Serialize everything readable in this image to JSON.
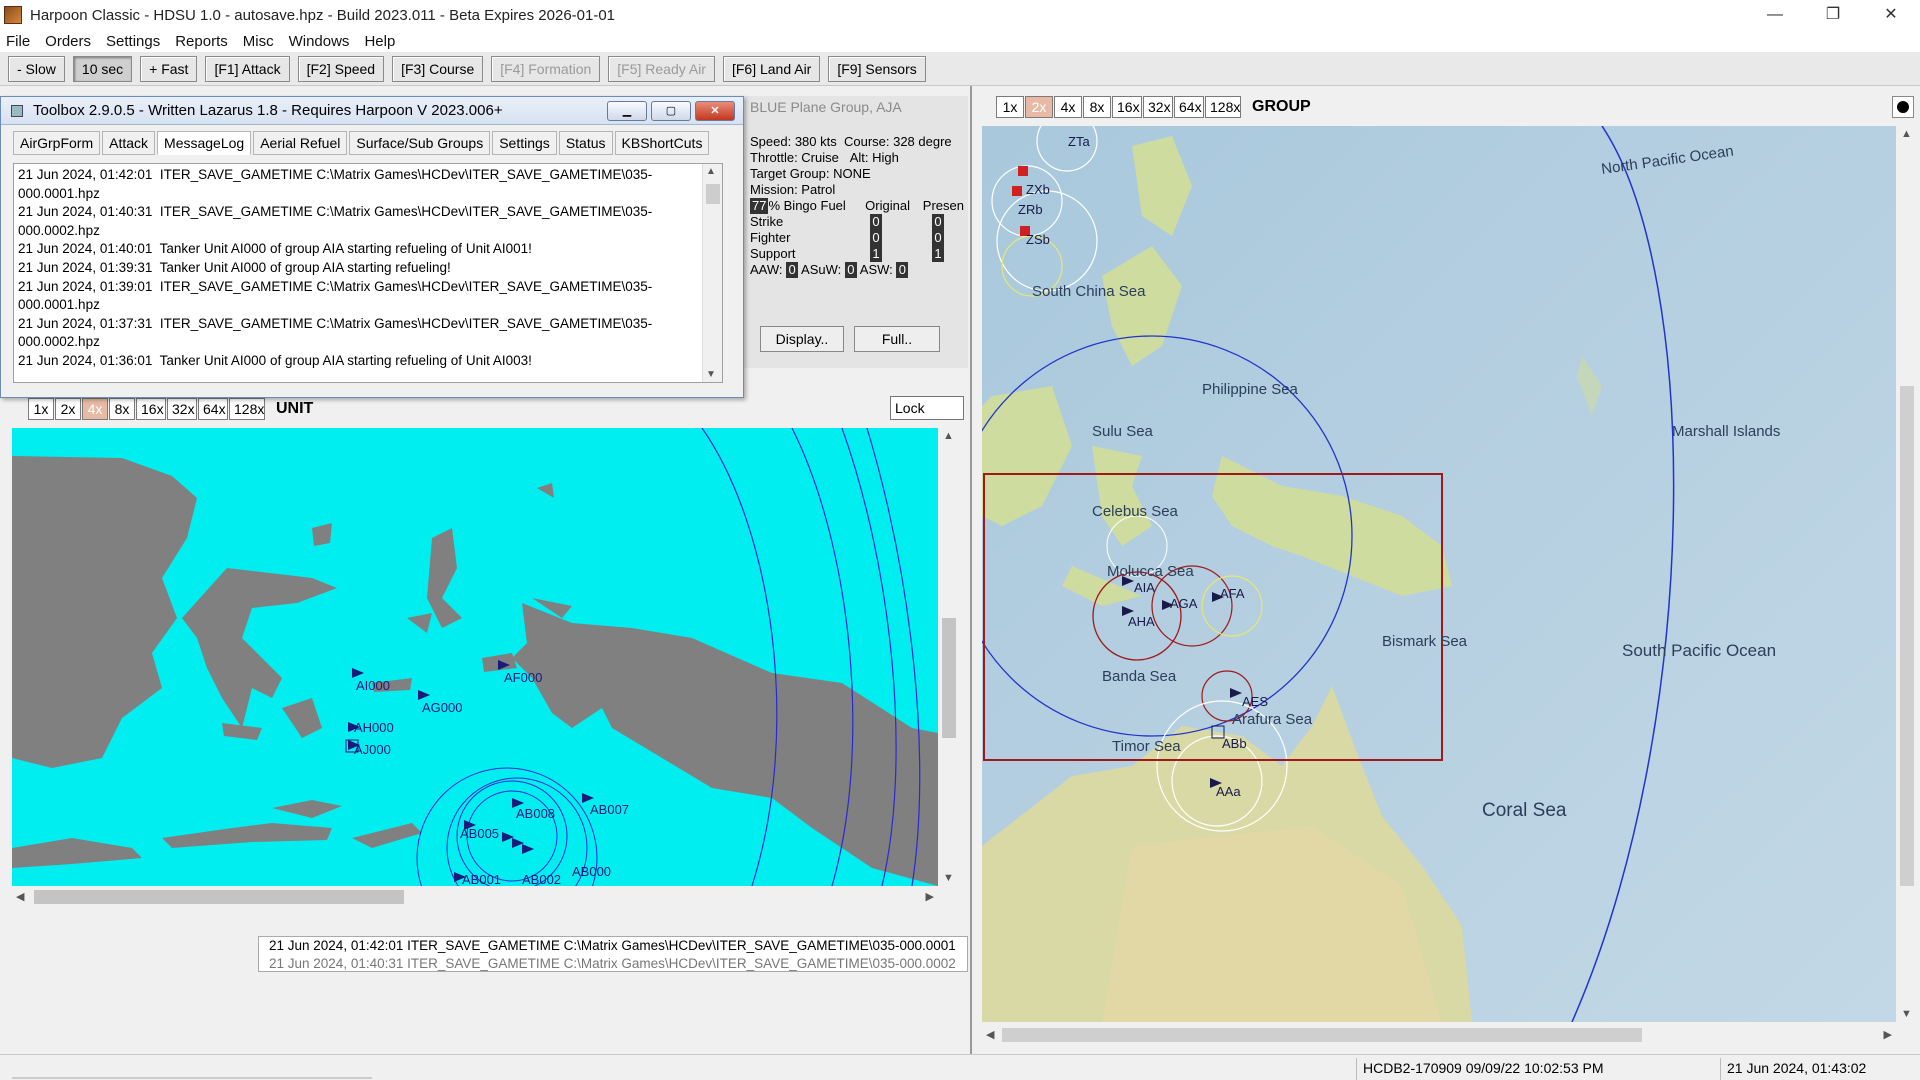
{
  "window": {
    "title": "Harpoon Classic - HDSU 1.0 - autosave.hpz - Build 2023.011 - Beta Expires 2026-01-01",
    "controls": [
      "—",
      "❐",
      "✕"
    ]
  },
  "menu": [
    "File",
    "Orders",
    "Settings",
    "Reports",
    "Misc",
    "Windows",
    "Help"
  ],
  "toolbar": [
    {
      "label": "- Slow",
      "state": "normal"
    },
    {
      "label": "10 sec",
      "state": "active"
    },
    {
      "label": "+ Fast",
      "state": "normal"
    },
    {
      "label": "[F1] Attack",
      "state": "normal"
    },
    {
      "label": "[F2] Speed",
      "state": "normal"
    },
    {
      "label": "[F3] Course",
      "state": "normal"
    },
    {
      "label": "[F4] Formation",
      "state": "disabled"
    },
    {
      "label": "[F5] Ready Air",
      "state": "disabled"
    },
    {
      "label": "[F6] Land Air",
      "state": "normal"
    },
    {
      "label": "[F9] Sensors",
      "state": "normal"
    }
  ],
  "toolbox": {
    "title": "Toolbox 2.9.0.5 - Written Lazarus 1.8 - Requires Harpoon V 2023.006+",
    "tabs": [
      "AirGrpForm",
      "Attack",
      "MessageLog",
      "Aerial Refuel",
      "Surface/Sub Groups",
      "Settings",
      "Status",
      "KBShortCuts"
    ],
    "selected_tab": "MessageLog",
    "log": [
      "21 Jun 2024, 01:42:01  ITER_SAVE_GAMETIME C:\\Matrix Games\\HCDev\\ITER_SAVE_GAMETIME\\035-000.0001.hpz",
      "21 Jun 2024, 01:40:31  ITER_SAVE_GAMETIME C:\\Matrix Games\\HCDev\\ITER_SAVE_GAMETIME\\035-000.0002.hpz",
      "21 Jun 2024, 01:40:01  Tanker Unit AI000 of group AIA starting refueling of Unit AI001!",
      "21 Jun 2024, 01:39:31  Tanker Unit AI000 of group AIA starting refueling!",
      "21 Jun 2024, 01:39:01  ITER_SAVE_GAMETIME C:\\Matrix Games\\HCDev\\ITER_SAVE_GAMETIME\\035-000.0001.hpz",
      "21 Jun 2024, 01:37:31  ITER_SAVE_GAMETIME C:\\Matrix Games\\HCDev\\ITER_SAVE_GAMETIME\\035-000.0002.hpz",
      "21 Jun 2024, 01:36:01  Tanker Unit AI000 of group AIA starting refueling of Unit AI003!"
    ]
  },
  "group_info": {
    "title": "BLUE Plane Group, AJA",
    "speed": "Speed: 380 kts",
    "course": "Course: 328 degre",
    "throttle": "Throttle: Cruise",
    "alt": "Alt: High",
    "target": "Target Group: NONE",
    "mission": "Mission: Patrol",
    "bingo_pct": "77",
    "bingo_label": "% Bingo Fuel",
    "col_original": "Original",
    "col_present": "Presen",
    "rows": [
      {
        "label": "Strike",
        "original": "0",
        "present": "0"
      },
      {
        "label": "Fighter",
        "original": "0",
        "present": "0"
      },
      {
        "label": "Support",
        "original": "1",
        "present": "1"
      }
    ],
    "aaw_label": "AAW:",
    "aaw": "0",
    "asuw_label": "ASuW:",
    "asuw": "0",
    "asw_label": "ASW:",
    "asw": "0",
    "display_btn": "Display..",
    "full_btn": "Full.."
  },
  "unit_map": {
    "zoom": [
      "1x",
      "2x",
      "4x",
      "8x",
      "16x",
      "32x",
      "64x",
      "128x"
    ],
    "selected_zoom": "4x",
    "label": "UNIT",
    "lock_label": "Lock",
    "units": [
      "AI000",
      "AF000",
      "AG000",
      "AH000",
      "AJ000",
      "AB008",
      "AB007",
      "AB005",
      "AB000",
      "AB001",
      "AB002"
    ],
    "colors": {
      "sea": "#00eef0",
      "land": "#808080",
      "unit": "#1a1a7a",
      "ring": "#2a2ad0"
    }
  },
  "message_strip": {
    "line1": "21 Jun 2024, 01:42:01  ITER_SAVE_GAMETIME C:\\Matrix Games\\HCDev\\ITER_SAVE_GAMETIME\\035-000.0001",
    "line2": "21 Jun 2024, 01:40:31  ITER_SAVE_GAMETIME C:\\Matrix Games\\HCDev\\ITER_SAVE_GAMETIME\\035-000.0002"
  },
  "group_map": {
    "zoom": [
      "1x",
      "2x",
      "4x",
      "8x",
      "16x",
      "32x",
      "64x",
      "128x"
    ],
    "selected_zoom": "2x",
    "label": "GROUP",
    "seas": [
      "North Pacific Ocean",
      "Philippine Sea",
      "Sulu Sea",
      "Celebus Sea",
      "Molucca Sea",
      "Banda Sea",
      "Timor Sea",
      "Arafura Sea",
      "Coral Sea",
      "Bismark Sea",
      "South Pacific Ocean",
      "Marshall Islands",
      "South China Sea"
    ],
    "groups": [
      "ZTa",
      "ZXb",
      "ZRb",
      "ZSb",
      "AIA",
      "AGA",
      "AFA",
      "AHA",
      "AES",
      "ABb",
      "AAa"
    ],
    "colors": {
      "ocean": "#b9d3e3",
      "land": "#cfdca0",
      "ring": "#2233cc",
      "box": "#a01818"
    }
  },
  "status": {
    "build": "HCDB2-170909 09/09/22 10:02:53 PM",
    "time": "21 Jun 2024, 01:43:02"
  }
}
